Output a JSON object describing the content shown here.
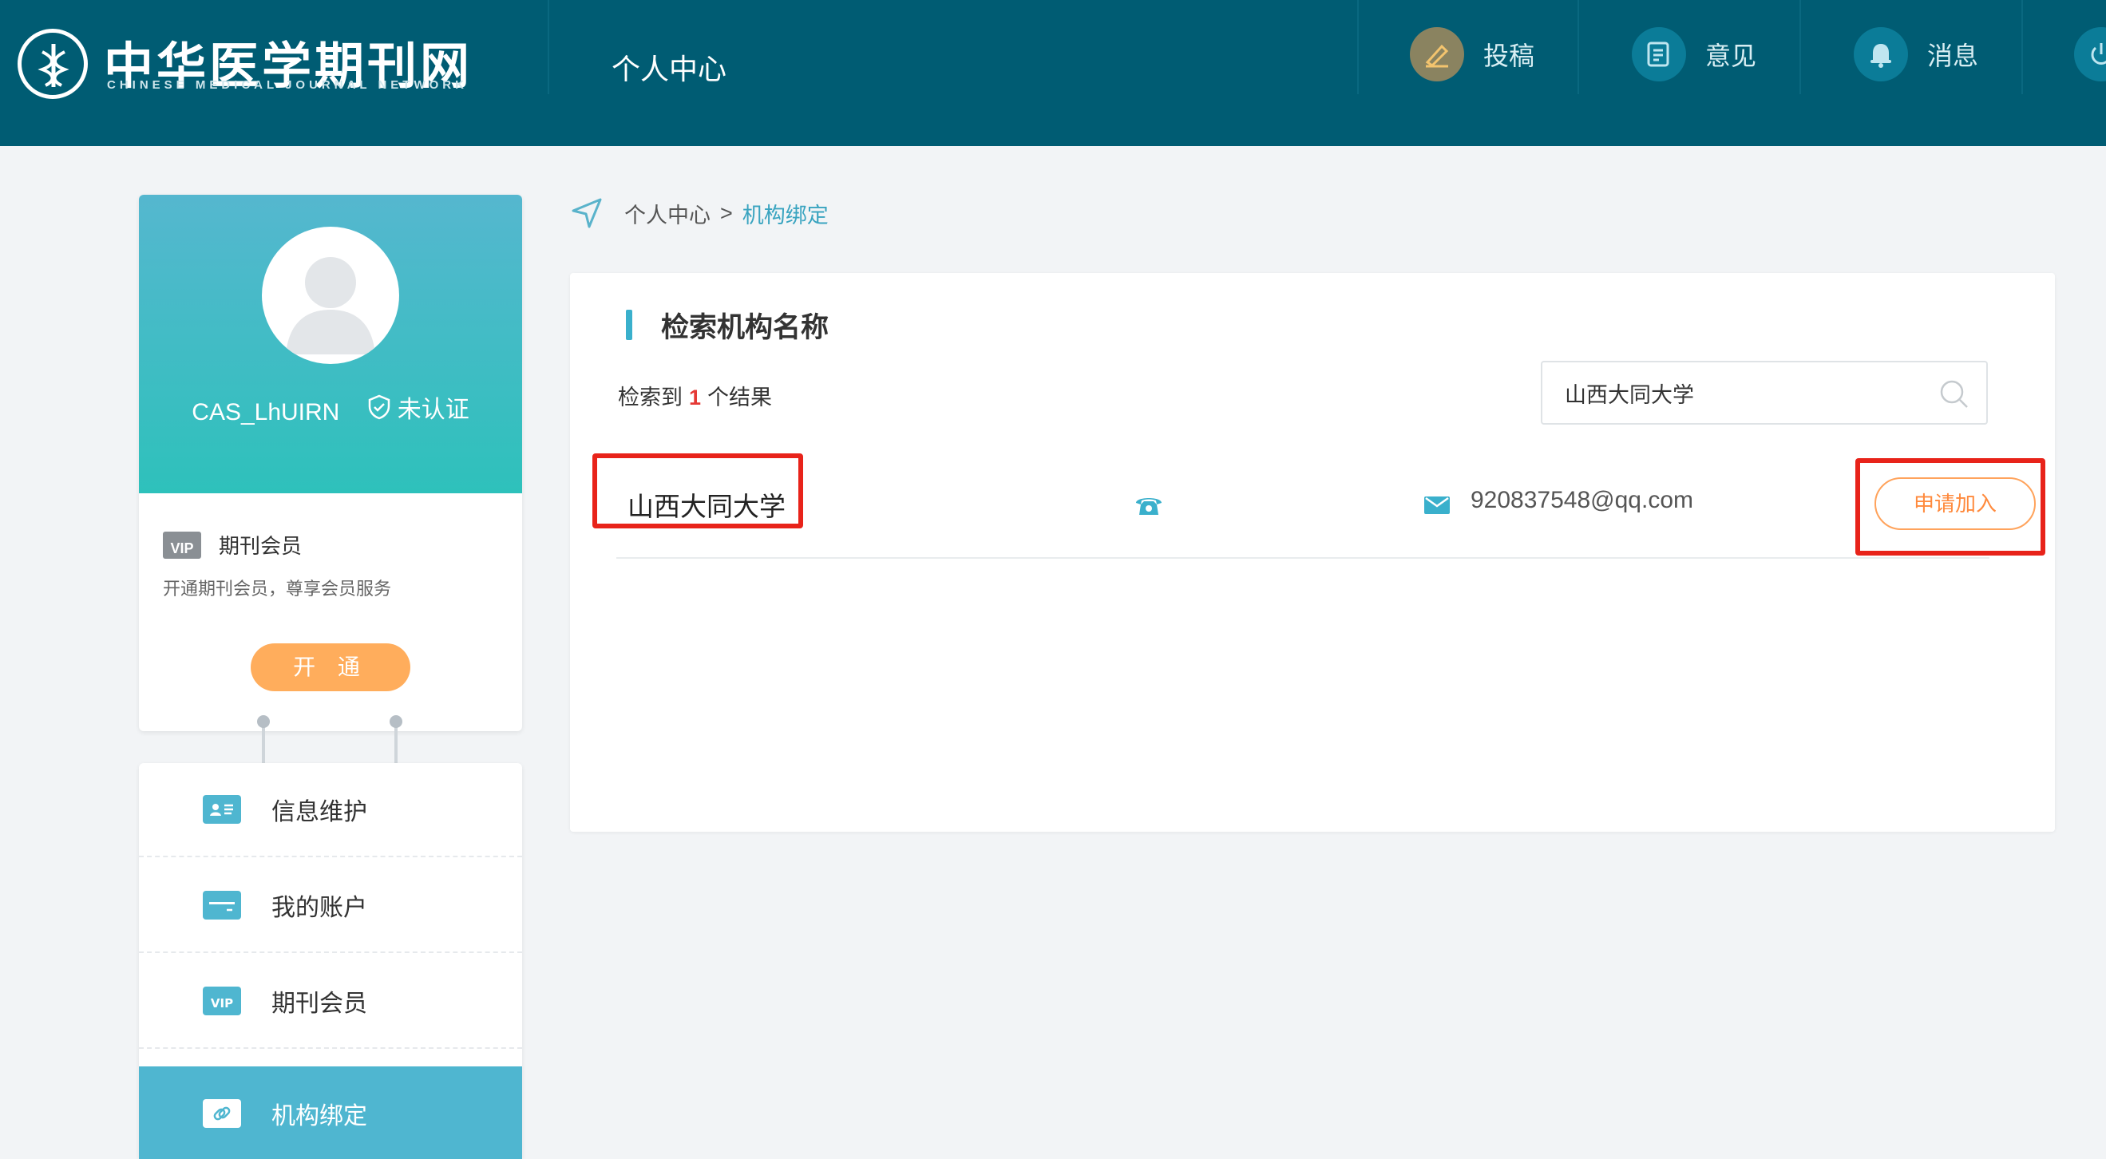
{
  "header": {
    "logo_cn": "中华医学期刊网",
    "logo_en": "CHINESE MEDICAL JOURNAL NETWORK",
    "page_title": "个人中心",
    "actions": [
      {
        "label": "投稿",
        "icon": "pen-icon"
      },
      {
        "label": "意见",
        "icon": "feedback-icon"
      },
      {
        "label": "消息",
        "icon": "bell-icon"
      }
    ]
  },
  "profile": {
    "username": "CAS_LhUIRN",
    "verify_status": "未认证",
    "vip_badge": "VIP",
    "vip_title": "期刊会员",
    "vip_desc": "开通期刊会员，尊享会员服务",
    "open_button": "开 通"
  },
  "menu": {
    "items": [
      {
        "label": "信息维护",
        "icon": "id-card-icon",
        "active": false
      },
      {
        "label": "我的账户",
        "icon": "wallet-card-icon",
        "active": false
      },
      {
        "label": "期刊会员",
        "icon": "vip-icon",
        "active": false
      },
      {
        "label": "机构绑定",
        "icon": "link-icon",
        "active": true
      }
    ]
  },
  "breadcrumb": {
    "root": "个人中心",
    "separator": ">",
    "current": "机构绑定"
  },
  "search": {
    "title": "检索机构名称",
    "result_prefix": "检索到",
    "result_count": "1",
    "result_suffix": "个结果",
    "query": "山西大同大学"
  },
  "results": [
    {
      "name": "山西大同大学",
      "email": "920837548@qq.com",
      "join_label": "申请加入"
    }
  ],
  "colors": {
    "header_bg": "#005c73",
    "accent": "#4fb6d0",
    "orange": "#ffad5c",
    "highlight_red": "#e8231a"
  }
}
